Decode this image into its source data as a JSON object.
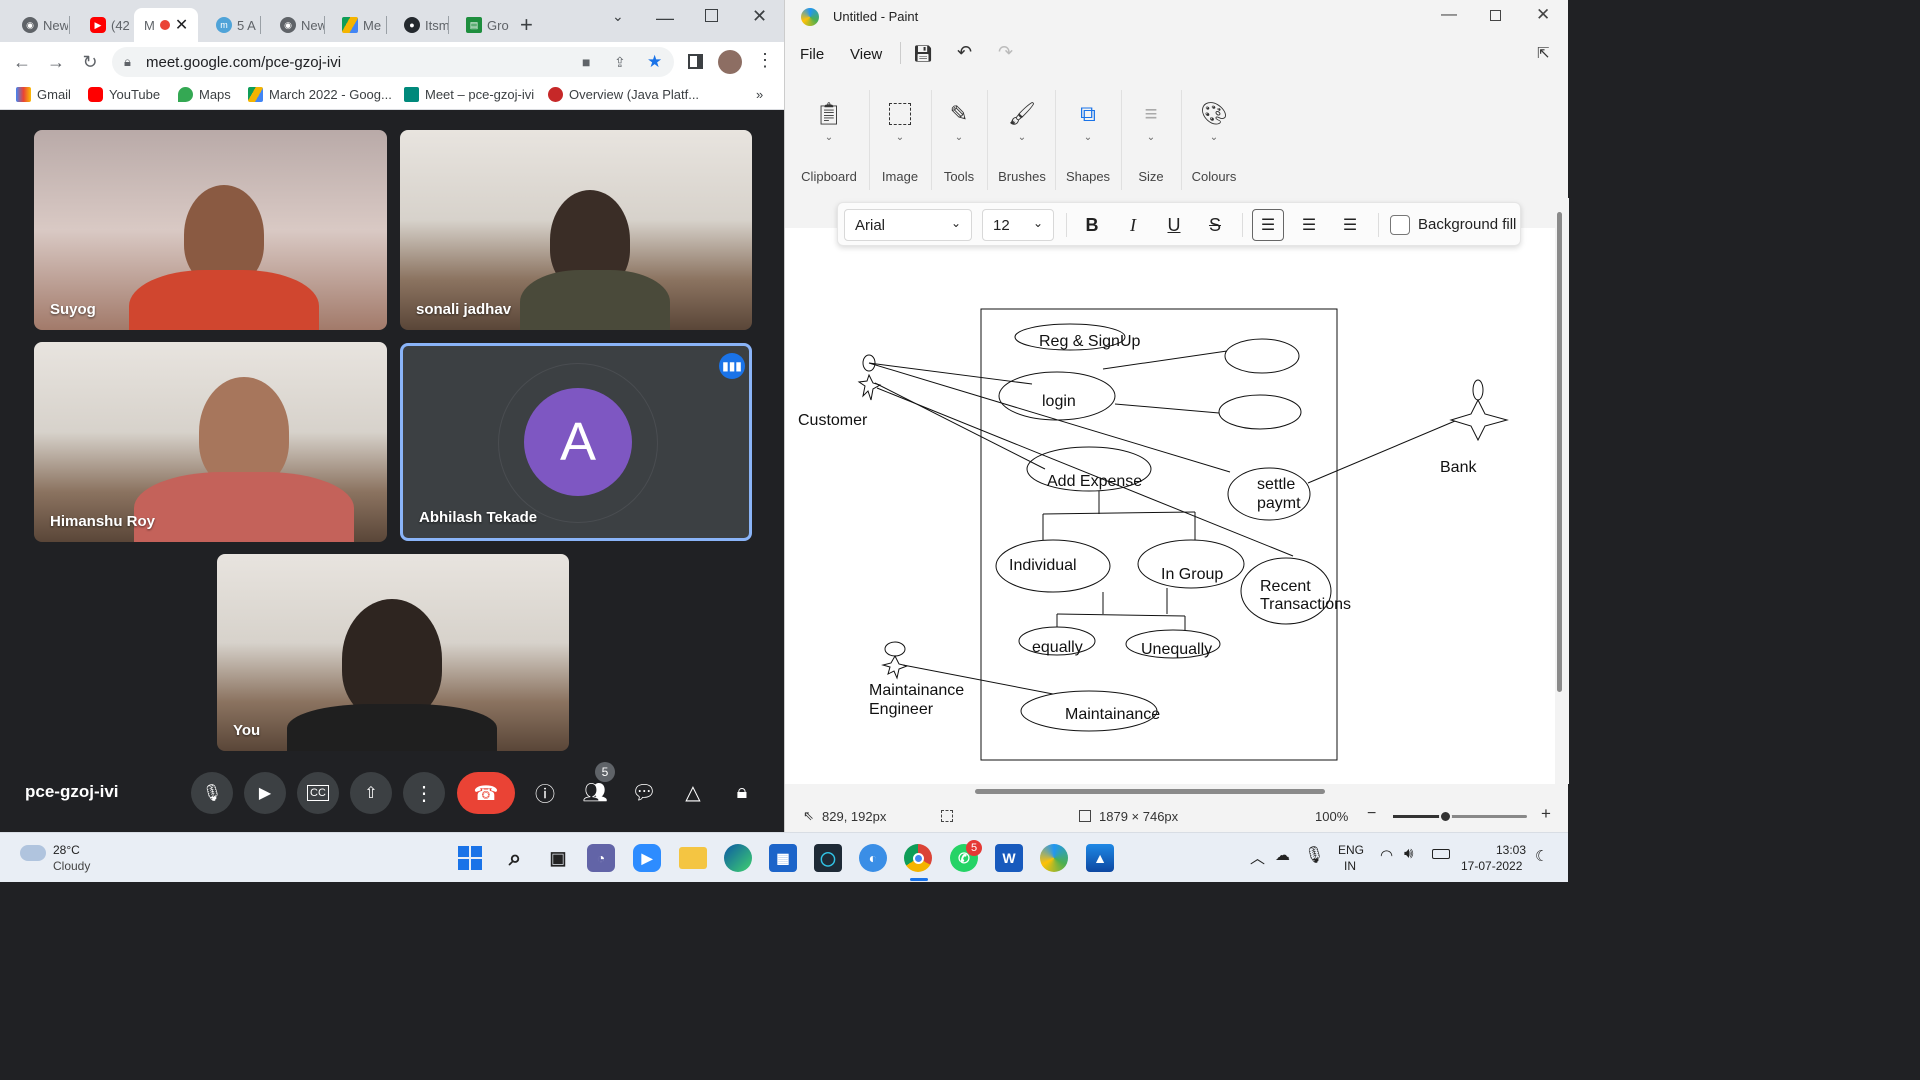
{
  "chrome": {
    "tabs": [
      {
        "label": "New",
        "icon": "chrome-icon"
      },
      {
        "label": "(42",
        "icon": "youtube-icon"
      },
      {
        "label": "M",
        "icon": "meet-icon",
        "active": true
      },
      {
        "label": "5 A",
        "icon": "m-icon"
      },
      {
        "label": "New",
        "icon": "chrome-icon"
      },
      {
        "label": "Me",
        "icon": "drive-icon"
      },
      {
        "label": "Itsm",
        "icon": "github-icon"
      },
      {
        "label": "Gro",
        "icon": "classroom-icon"
      }
    ],
    "url": "meet.google.com/pce-gzoj-ivi",
    "bookmarks": [
      "Gmail",
      "YouTube",
      "Maps",
      "March 2022 - Goog...",
      "Meet – pce-gzoj-ivi",
      "Overview (Java Platf..."
    ],
    "bookmarks_more": "»"
  },
  "meet": {
    "participants": [
      {
        "name": "Suyog"
      },
      {
        "name": "sonali jadhav"
      },
      {
        "name": "Himanshu Roy"
      },
      {
        "name": "Abhilash Tekade",
        "avatar_letter": "A",
        "avatar_color": "#7e57c2"
      },
      {
        "name": "You"
      }
    ],
    "meeting_code": "pce-gzoj-ivi",
    "people_count": "5",
    "end_call_color": "#ea4335"
  },
  "paint": {
    "title": "Untitled - Paint",
    "menu": [
      "File",
      "View"
    ],
    "ribbon_groups": [
      "Clipboard",
      "Image",
      "Tools",
      "Brushes",
      "Shapes",
      "Size",
      "Colours"
    ],
    "text_toolbar": {
      "font": "Arial",
      "size": "12",
      "bold": "B",
      "italic": "I",
      "underline": "U",
      "strike": "S",
      "background_fill": "Background fill"
    },
    "diagram": {
      "actors": [
        "Customer",
        "Bank",
        "Maintainance",
        "Engineer"
      ],
      "use_cases": [
        "Reg & SignUp",
        "login",
        "Add Expense",
        "settle",
        "paymt",
        "Individual",
        "In Group",
        "Recent",
        "Transactions",
        "equally",
        "Unequally",
        "Maintainance"
      ]
    },
    "status": {
      "cursor": "829, 192px",
      "canvas_size": "1879 × 746px",
      "zoom": "100%"
    }
  },
  "taskbar": {
    "weather_temp": "28°C",
    "weather_desc": "Cloudy",
    "whatsapp_badge": "5",
    "lang": "ENG",
    "region": "IN",
    "time": "13:03",
    "date": "17-07-2022"
  }
}
